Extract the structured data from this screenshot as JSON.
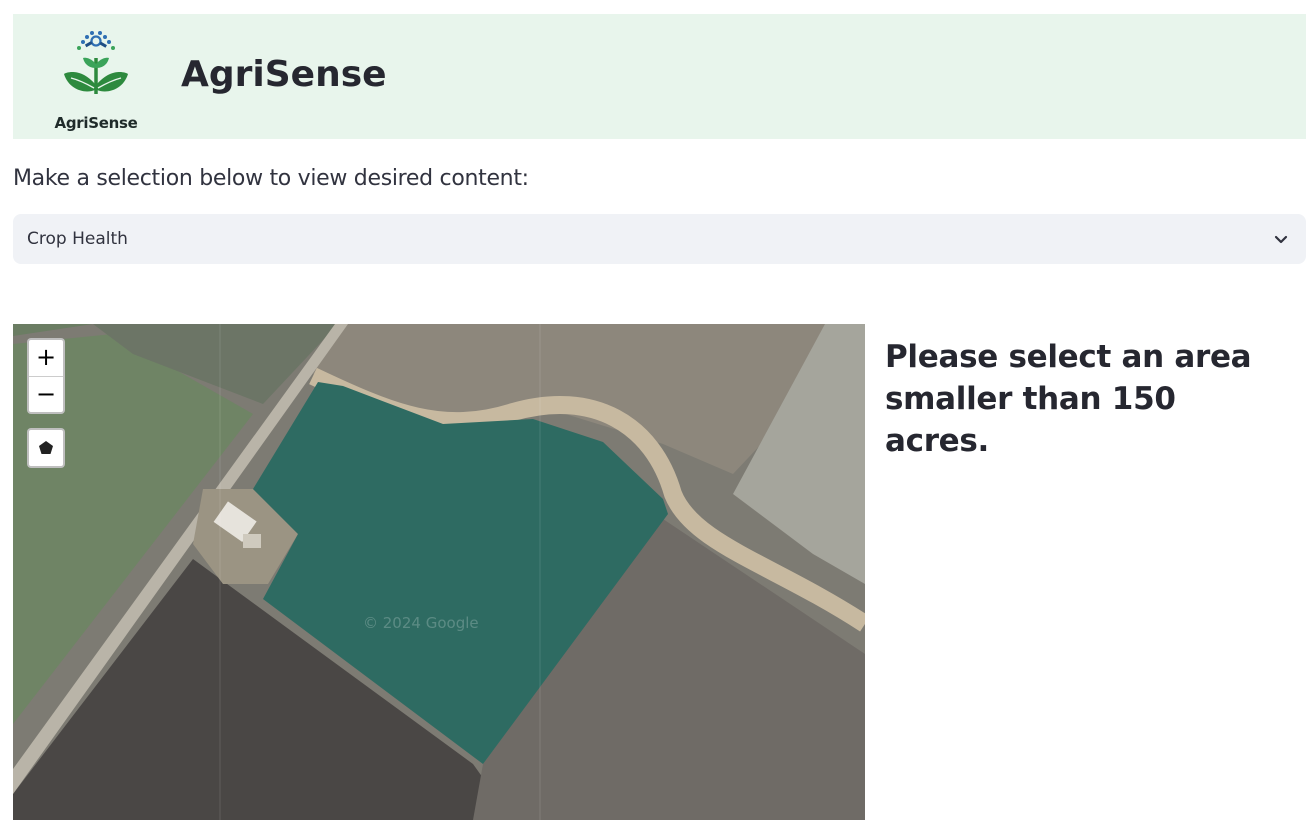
{
  "header": {
    "logo_text": "AgriSense",
    "title": "AgriSense",
    "background_color": "#e8f5ec"
  },
  "prompt": "Make a selection below to view desired content:",
  "content_select": {
    "selected": "Crop Health",
    "icon": "chevron-down-icon"
  },
  "map": {
    "zoom_in_label": "+",
    "zoom_out_label": "−",
    "draw_tool_icon": "polygon-icon",
    "attribution_watermark": "© 2024 Google",
    "highlight_color": "#2e6b62"
  },
  "message": "Please select an area smaller than 150 acres."
}
